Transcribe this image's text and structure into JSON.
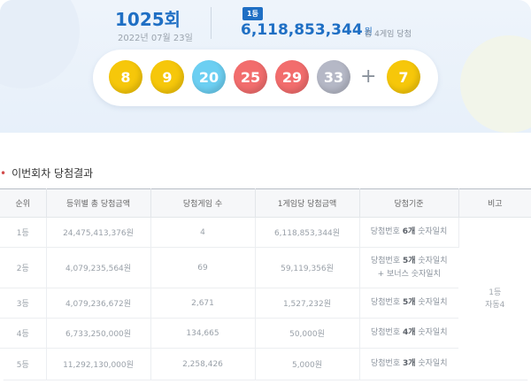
{
  "header": {
    "round": "1025회",
    "date": "2022년 07월 23일",
    "rank_badge": "1등",
    "prize_amount": "6,118,853,344",
    "prize_unit": "원",
    "prize_note": "총 4게임 당첨"
  },
  "balls": [
    {
      "number": "8",
      "color": "#f6c70a"
    },
    {
      "number": "9",
      "color": "#f6c70a"
    },
    {
      "number": "20",
      "color": "#6ccff2"
    },
    {
      "number": "25",
      "color": "#f26d6d"
    },
    {
      "number": "29",
      "color": "#f26d6d"
    },
    {
      "number": "33",
      "color": "#b5b8c6"
    }
  ],
  "plus_sign": "+",
  "bonus_ball": {
    "number": "7",
    "color": "#f6c70a"
  },
  "section": {
    "title": "이번회차 당첨결과"
  },
  "table": {
    "columns": [
      "순위",
      "등위별 총 당첨금액",
      "당첨게임 수",
      "1게임당 당첨금액",
      "당첨기준",
      "비고"
    ],
    "rows": [
      {
        "rank": "1등",
        "total": "24,475,413,376원",
        "winners": "4",
        "per_game": "6,118,853,344원",
        "criteria_pre": "당첨번호 ",
        "criteria_bold": "6개",
        "criteria_post": " 숫자일치",
        "criteria_line2": ""
      },
      {
        "rank": "2등",
        "total": "4,079,235,564원",
        "winners": "69",
        "per_game": "59,119,356원",
        "criteria_pre": "당첨번호 ",
        "criteria_bold": "5개",
        "criteria_post": " 숫자일치",
        "criteria_line2": "+ 보너스 숫자일치"
      },
      {
        "rank": "3등",
        "total": "4,079,236,672원",
        "winners": "2,671",
        "per_game": "1,527,232원",
        "criteria_pre": "당첨번호 ",
        "criteria_bold": "5개",
        "criteria_post": " 숫자일치",
        "criteria_line2": ""
      },
      {
        "rank": "4등",
        "total": "6,733,250,000원",
        "winners": "134,665",
        "per_game": "50,000원",
        "criteria_pre": "당첨번호 ",
        "criteria_bold": "4개",
        "criteria_post": " 숫자일치",
        "criteria_line2": ""
      },
      {
        "rank": "5등",
        "total": "11,292,130,000원",
        "winners": "2,258,426",
        "per_game": "5,000원",
        "criteria_pre": "당첨번호 ",
        "criteria_bold": "3개",
        "criteria_post": " 숫자일치",
        "criteria_line2": ""
      }
    ],
    "note_line1": "1등",
    "note_line2": "자동4"
  }
}
